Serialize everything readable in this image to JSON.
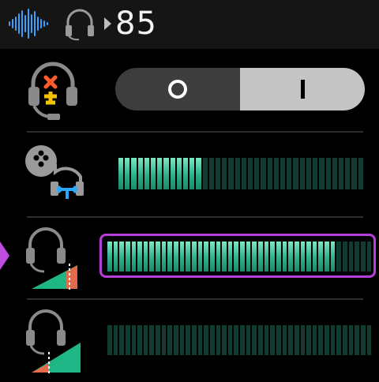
{
  "header": {
    "value": "85",
    "waveform_icon": "audio-waveform-icon",
    "headset_icon": "headset-icon"
  },
  "rows": [
    {
      "id": "sidetone-mute",
      "icon": "headset-mic-mute-icon",
      "control": "toggle",
      "toggle": {
        "off_label": "O",
        "on_label": "I",
        "state": "on"
      }
    },
    {
      "id": "chat-mix",
      "icon": "controller-headset-chat-icon",
      "control": "meter",
      "level": 0.35
    },
    {
      "id": "headset-volume",
      "icon": "headset-volume-high-icon",
      "control": "meter",
      "level": 0.86,
      "selected": true
    },
    {
      "id": "mic-volume",
      "icon": "headset-volume-low-icon",
      "control": "meter",
      "level": 0.0
    }
  ],
  "colors": {
    "accent": "#b53fd8",
    "meter_on": "#2bb08a",
    "meter_off": "#0f3c30",
    "toggle_on": "#c4c4c4",
    "toggle_off": "#3d3d3d"
  }
}
